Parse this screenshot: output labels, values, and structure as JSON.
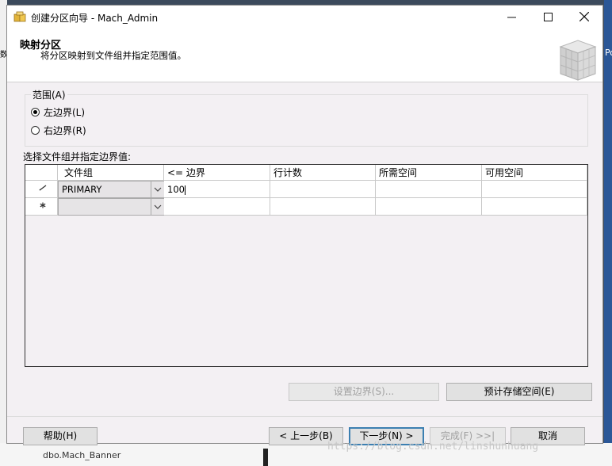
{
  "window": {
    "title": "创建分区向导 - Mach_Admin"
  },
  "header": {
    "title": "映射分区",
    "subtitle": "将分区映射到文件组并指定范围值。"
  },
  "range": {
    "label": "范围(A)",
    "options": [
      {
        "label": "左边界(L)",
        "selected": true
      },
      {
        "label": "右边界(R)",
        "selected": false
      }
    ]
  },
  "grid": {
    "caption": "选择文件组并指定边界值:",
    "columns": [
      "文件组",
      "<= 边界",
      "行计数",
      "所需空间",
      "可用空间"
    ],
    "rows": [
      {
        "filegroup": "PRIMARY",
        "boundary": "100",
        "rowcount": "",
        "required": "",
        "available": ""
      },
      {
        "filegroup": "",
        "boundary": "",
        "rowcount": "",
        "required": "",
        "available": ""
      }
    ]
  },
  "buttons": {
    "set_boundary": "设置边界(S)...",
    "estimate_storage": "预计存储空间(E)",
    "help": "帮助(H)",
    "back": "< 上一步(B)",
    "next": "下一步(N) >",
    "finish": "完成(F) >>|",
    "cancel": "取消"
  },
  "background": {
    "tree_item": "dbo.Mach_Banner",
    "right_text": "Po",
    "left_text": "数"
  },
  "watermark": "https://blog.csdn.net/linshunhuang"
}
